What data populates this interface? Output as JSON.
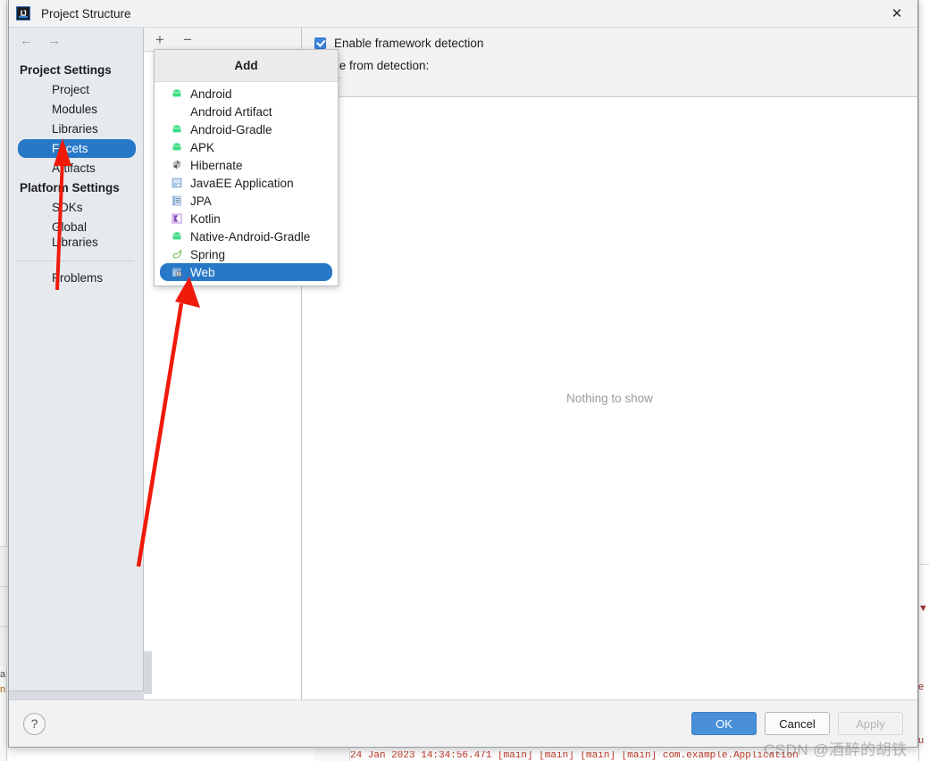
{
  "window": {
    "title": "Project Structure",
    "app_icon": "intellij-idea-icon",
    "close_icon": "close-icon"
  },
  "sidebar": {
    "back_icon": "arrow-left-icon",
    "forward_icon": "arrow-right-icon",
    "groups": [
      {
        "label": "Project Settings",
        "items": [
          {
            "label": "Project",
            "selected": false
          },
          {
            "label": "Modules",
            "selected": false
          },
          {
            "label": "Libraries",
            "selected": false
          },
          {
            "label": "Facets",
            "selected": true
          },
          {
            "label": "Artifacts",
            "selected": false
          }
        ]
      },
      {
        "label": "Platform Settings",
        "items": [
          {
            "label": "SDKs",
            "selected": false
          },
          {
            "label": "Global Libraries",
            "selected": false
          }
        ]
      }
    ],
    "problems": {
      "label": "Problems",
      "selected": false
    }
  },
  "facets_panel": {
    "add_button_label": "+",
    "remove_button_label": "−"
  },
  "add_menu": {
    "header": "Add",
    "items": [
      {
        "label": "Android",
        "icon": "android-icon",
        "selected": false
      },
      {
        "label": "Android Artifact",
        "icon": "none",
        "selected": false
      },
      {
        "label": "Android-Gradle",
        "icon": "android-icon",
        "selected": false
      },
      {
        "label": "APK",
        "icon": "android-icon",
        "selected": false
      },
      {
        "label": "Hibernate",
        "icon": "hibernate-icon",
        "selected": false
      },
      {
        "label": "JavaEE Application",
        "icon": "javaee-icon",
        "selected": false
      },
      {
        "label": "JPA",
        "icon": "jpa-icon",
        "selected": false
      },
      {
        "label": "Kotlin",
        "icon": "kotlin-icon",
        "selected": false
      },
      {
        "label": "Native-Android-Gradle",
        "icon": "android-icon",
        "selected": false
      },
      {
        "label": "Spring",
        "icon": "spring-icon",
        "selected": false
      },
      {
        "label": "Web",
        "icon": "web-icon",
        "selected": true
      }
    ]
  },
  "detail": {
    "enable_detection_label": "Enable framework detection",
    "enable_detection_checked": true,
    "exclude_label": "clude from detection:",
    "empty_message": "Nothing to show"
  },
  "buttons": {
    "help_label": "?",
    "ok_label": "OK",
    "cancel_label": "Cancel",
    "apply_label": "Apply"
  },
  "watermark": {
    "text": "CSDN @酒醉的胡铁"
  },
  "background": {
    "console_line": "24 Jan 2023 14:34:56.471 [main] [main] [main] [main] com.example.Application",
    "left_fragments": [
      "a",
      "n"
    ],
    "right_fragments": [
      "▼",
      "e",
      "u"
    ]
  },
  "colors": {
    "selection_blue": "#2878c8",
    "primary_button": "#4a90d9",
    "annotation_red": "#f01a0a",
    "sidebar_bg": "#e6eaee",
    "dialog_bg": "#f2f2f2"
  }
}
